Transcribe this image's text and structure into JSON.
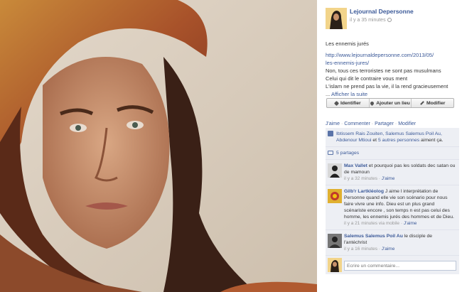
{
  "post": {
    "author": "Lejournal Depersonne",
    "time": "il y a 35 minutes",
    "title": "Les ennemis jurés",
    "link_line1": "http://www.lejournaldepersonne.com/2013/05/",
    "link_line2": "les-ennemis-jures/",
    "line3": "Non, tous ces terroristes ne sont pas musulmans",
    "line4": "Celui qui dit le contraire vous ment",
    "line5": "L'islam ne prend pas la vie, il la rend gracieusement",
    "more_prefix": "...",
    "more": "Afficher la suite"
  },
  "photo_actions": {
    "tag": "Identifier",
    "place": "Ajouter un lieu",
    "edit": "Modifier"
  },
  "post_actions": {
    "like": "J'aime",
    "sep": "·",
    "comment": "Commenter",
    "share": "Partager",
    "edit": "Modifier"
  },
  "likes": {
    "names": "Ibtissem Rais Zouiten, Salemus Salemus Poil Au, Abdenour Mtioui",
    "and": "et",
    "others": "5 autres personnes",
    "suffix": "aiment ça."
  },
  "shares": "5 partages",
  "comments": [
    {
      "author": "Max Vallet",
      "text": "et pourquoi pas les soldats dec satan ou de mamoun",
      "time": "il y a 32 minutes",
      "via": "",
      "like": "J'aime"
    },
    {
      "author": "Gilb'r Lartkléolog",
      "text": "J aime l interprétation de Personne quand elle vie son scénario pour nous faire vivre une info. Dieu est un plus grand scénariste encore , son temps n est pas celui des homme, les ennemis jurés des hommes et de Dieu.",
      "time": "il y a 21 minutes",
      "via": "via mobile",
      "like": "J'aime"
    },
    {
      "author": "Salemus Salemus Poil Au",
      "text": "le disciple de l'antéchrist",
      "time": "il y a 16 minutes",
      "via": "",
      "like": "J'aime"
    }
  ],
  "comment_input": {
    "placeholder": "Ecrire un commentaire..."
  },
  "colors": {
    "link": "#3b5998",
    "feed_bg": "#edeff4"
  }
}
